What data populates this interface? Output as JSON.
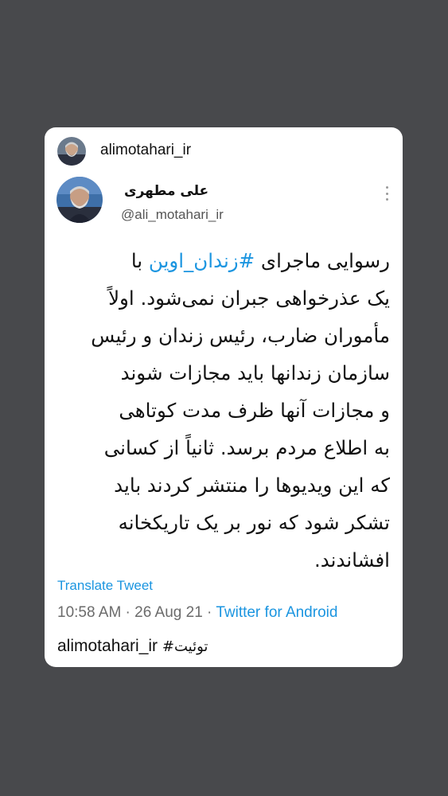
{
  "card": {
    "top_username": "alimotahari_ir",
    "display_name": "علی مطهری",
    "handle": "@ali_motahari_ir",
    "tweet_text_before": "رسوایی ماجرای ",
    "hashtag": "#زندان_اوین",
    "tweet_text_after": " با\nیک عذرخواهی جبران نمی‌شود. اولاً\nمأموران ضارب، رئیس زندان و رئیس\nسازمان زندانها باید مجازات شوند\nو مجازات آنها ظرف مدت کوتاهی\nبه اطلاع مردم برسد. ثانیاً از کسانی\nکه این ویدیوها را منتشر کردند باید\nتشکر شود که نور بر یک تاریکخانه\nافشاندند.",
    "translate_label": "Translate Tweet",
    "time": "10:58 AM",
    "separator": " · ",
    "date": "26 Aug 21",
    "source": "Twitter for Android",
    "footer_user": "alimotahari_ir",
    "footer_tag": "#توئیت"
  },
  "icons": {
    "more": "more-vertical-icon"
  }
}
